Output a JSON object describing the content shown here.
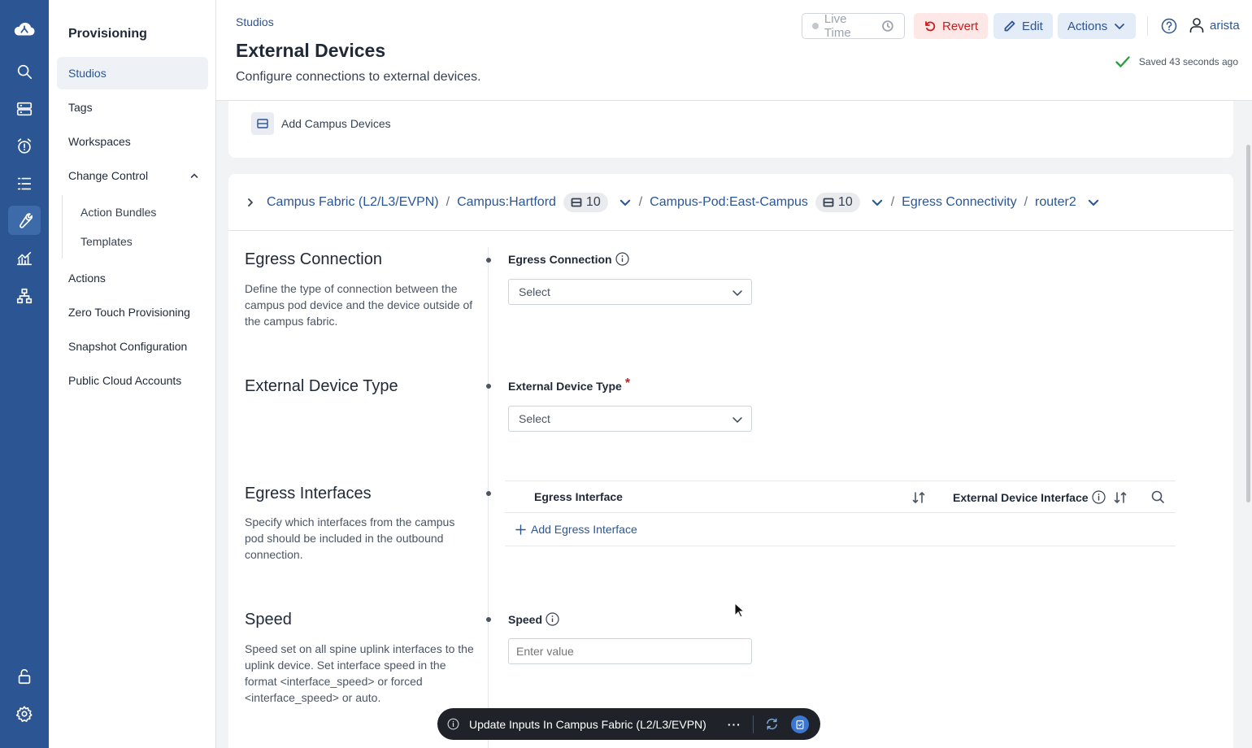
{
  "colors": {
    "rail": "#2c5593",
    "accent": "#2c5593",
    "danger": "#c81e1e",
    "success": "#2e9e44"
  },
  "rail": {
    "icons": [
      "cloud-logo-icon",
      "search-icon",
      "server-icon",
      "alarm-icon",
      "list-icon",
      "wrench-icon",
      "analytics-icon",
      "topology-icon",
      "unlock-icon",
      "settings-icon"
    ]
  },
  "sidebar": {
    "title": "Provisioning",
    "items": {
      "studios": "Studios",
      "tags": "Tags",
      "workspaces": "Workspaces",
      "change_control": "Change Control",
      "action_bundles": "Action Bundles",
      "templates": "Templates",
      "actions": "Actions",
      "ztp": "Zero Touch Provisioning",
      "snapshot": "Snapshot Configuration",
      "cloud": "Public Cloud Accounts"
    }
  },
  "header": {
    "breadcrumb": "Studios",
    "title": "External Devices",
    "subtitle": "Configure connections to external devices.",
    "live_time": "Live Time",
    "revert": "Revert",
    "edit": "Edit",
    "actions": "Actions",
    "user": "arista",
    "saved": "Saved 43 seconds ago"
  },
  "top_card": {
    "add_campus_devices": "Add Campus Devices"
  },
  "path": {
    "fabric": "Campus Fabric (L2/L3/EVPN)",
    "campus": "Campus:Hartford",
    "campus_count": "10",
    "pod": "Campus-Pod:East-Campus",
    "pod_count": "10",
    "egress": "Egress Connectivity",
    "router": "router2",
    "sep": "/"
  },
  "sections": {
    "egress_connection": {
      "title": "Egress Connection",
      "desc": "Define the type of connection between the campus pod device and the device outside of the campus fabric.",
      "label": "Egress Connection",
      "value": "Select"
    },
    "device_type": {
      "title": "External Device Type",
      "label": "External Device Type",
      "required": "*",
      "value": "Select"
    },
    "egress_interfaces": {
      "title": "Egress Interfaces",
      "desc": "Specify which interfaces from the campus pod should be included in the outbound connection.",
      "col1": "Egress Interface",
      "col2": "External Device Interface",
      "add": "Add Egress Interface"
    },
    "speed": {
      "title": "Speed",
      "desc": "Speed set on all spine uplink interfaces to the uplink device. Set interface speed in the format <interface_speed> or forced <interface_speed> or auto.",
      "label": "Speed",
      "placeholder": "Enter value"
    }
  },
  "toast": {
    "text": "Update Inputs In Campus Fabric (L2/L3/EVPN)",
    "more": "···"
  }
}
